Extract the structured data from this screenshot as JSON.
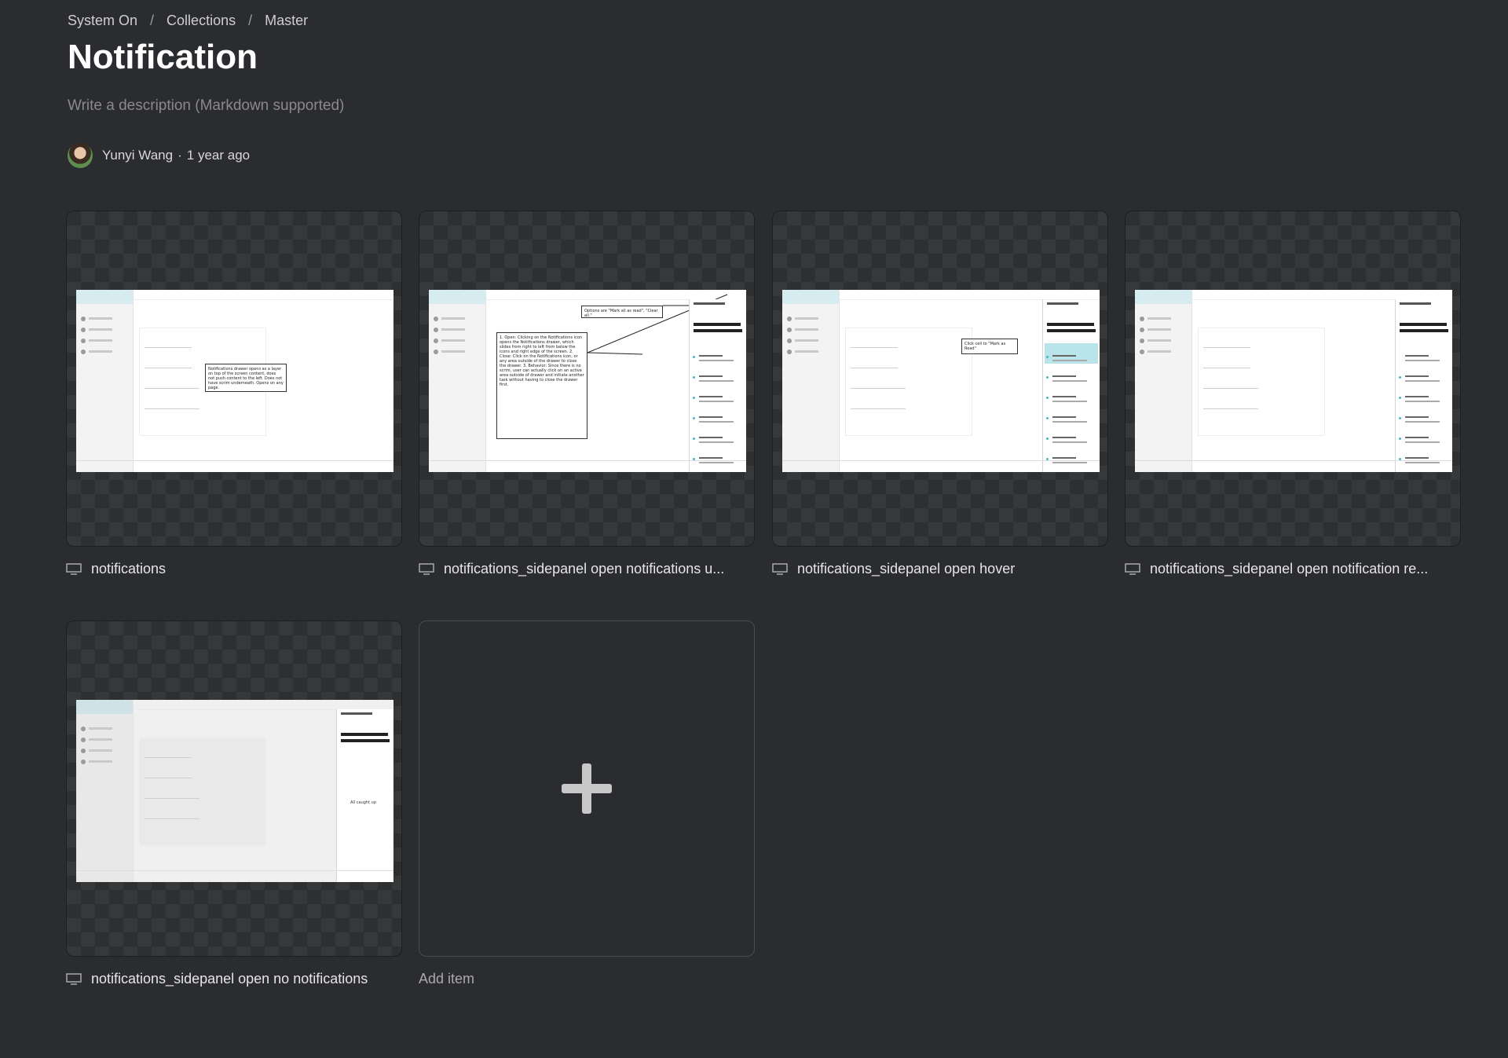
{
  "breadcrumb": {
    "items": [
      "System On",
      "Collections",
      "Master"
    ],
    "separator": "/"
  },
  "page": {
    "title": "Notification",
    "description_placeholder": "Write a description (Markdown supported)"
  },
  "author": {
    "name": "Yunyi Wang",
    "separator": "·",
    "time": "1 year ago"
  },
  "items": [
    {
      "label": "notifications",
      "icon": "screen-icon"
    },
    {
      "label": "notifications_sidepanel open notifications u...",
      "icon": "screen-icon"
    },
    {
      "label": "notifications_sidepanel open hover",
      "icon": "screen-icon"
    },
    {
      "label": "notifications_sidepanel open notification re...",
      "icon": "screen-icon"
    },
    {
      "label": "notifications_sidepanel open no notifications",
      "icon": "screen-icon"
    }
  ],
  "thumbnails": {
    "note_drawer": "Notifications drawer opens as a layer on top of the screen content, does not push content to the left. Does not have scrim underneath. Opens on any page.",
    "note_options": "Options are \"Mark all as read\", \"Clear all.\"",
    "note_behavior": "1. Open: Clicking on the Notifications icon opens the Notifications drawer, which slides from right to left from below the icons and right edge of the screen. 2. Close: Click on the Notifications icon, or any area outside of the drawer to close the drawer. 3. Behavior: Since there is no scrim, user can actually click on an active area outside of drawer and initiate another task without having to close the drawer first.",
    "note_hover": "Click cell to \"Mark as Read\"",
    "all_caught_up": "All caught up"
  },
  "add_item": {
    "label": "Add item",
    "icon": "plus-icon"
  },
  "colors": {
    "background": "#2b2c2f",
    "accent": "#49b6c9"
  }
}
